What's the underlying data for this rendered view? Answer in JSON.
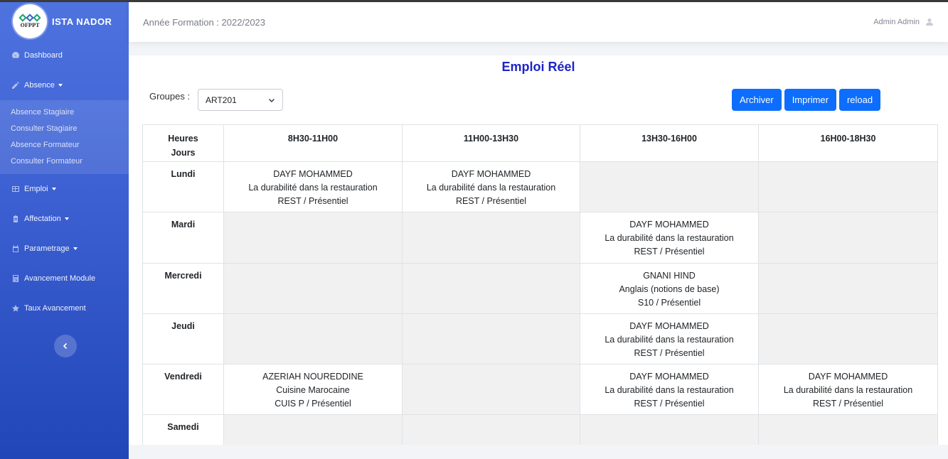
{
  "brand": {
    "name": "ISTA NADOR",
    "logo_text": "OFPPT"
  },
  "sidebar": {
    "items": [
      {
        "label": "Dashboard",
        "icon": "dashboard-icon"
      },
      {
        "label": "Absence",
        "icon": "pencil-icon",
        "caret": true
      },
      {
        "label": "Emploi",
        "icon": "table-icon",
        "caret": true
      },
      {
        "label": "Affectation",
        "icon": "clipboard-icon",
        "caret": true
      },
      {
        "label": "Parametrage",
        "icon": "calendar-icon",
        "caret": true
      },
      {
        "label": "Avancement Module",
        "icon": "calculator-icon"
      },
      {
        "label": "Taux Avancement",
        "icon": "star-icon"
      }
    ],
    "absence_sub": [
      "Absence Stagiaire",
      "Consulter Stagiaire",
      "Absence Formateur",
      "Consulter Formateur"
    ]
  },
  "header": {
    "year": "Année Formation : 2022/2023",
    "user": "Admin Admin"
  },
  "main": {
    "title": "Emploi Réel",
    "groupes_label": "Groupes :",
    "groupes_value": "ART201",
    "buttons": {
      "archiver": "Archiver",
      "imprimer": "Imprimer",
      "reload": "reload"
    }
  },
  "schedule": {
    "corner_line1": "Heures",
    "corner_line2": "Jours",
    "slots": [
      "8H30-11H00",
      "11H00-13H30",
      "13H30-16H00",
      "16H00-18H30"
    ],
    "rows": [
      {
        "day": "Lundi",
        "cells": [
          {
            "formateur": "DAYF MOHAMMED",
            "module": "La durabilité dans la restauration",
            "salle": "REST / Présentiel"
          },
          {
            "formateur": "DAYF MOHAMMED",
            "module": "La durabilité dans la restauration",
            "salle": "REST / Présentiel"
          },
          null,
          null
        ]
      },
      {
        "day": "Mardi",
        "cells": [
          null,
          null,
          {
            "formateur": "DAYF MOHAMMED",
            "module": "La durabilité dans la restauration",
            "salle": "REST / Présentiel"
          },
          null
        ]
      },
      {
        "day": "Mercredi",
        "cells": [
          null,
          null,
          {
            "formateur": "GNANI HIND",
            "module": "Anglais (notions de base)",
            "salle": "S10 / Présentiel"
          },
          null
        ]
      },
      {
        "day": "Jeudi",
        "cells": [
          null,
          null,
          {
            "formateur": "DAYF MOHAMMED",
            "module": "La durabilité dans la restauration",
            "salle": "REST / Présentiel"
          },
          null
        ]
      },
      {
        "day": "Vendredi",
        "cells": [
          {
            "formateur": "AZERIAH NOUREDDINE",
            "module": "Cuisine Marocaine",
            "salle": "CUIS P / Présentiel"
          },
          null,
          {
            "formateur": "DAYF MOHAMMED",
            "module": "La durabilité dans la restauration",
            "salle": "REST / Présentiel"
          },
          {
            "formateur": "DAYF MOHAMMED",
            "module": "La durabilité dans la restauration",
            "salle": "REST / Présentiel"
          }
        ]
      },
      {
        "day": "Samedi",
        "cells": [
          null,
          null,
          null,
          null
        ]
      }
    ]
  },
  "colors": {
    "sidebar_top": "#4e73df",
    "sidebar_bottom": "#2146b8",
    "title": "#1d24c6",
    "button": "#0d6efd",
    "empty_cell": "#f1f1f1"
  }
}
